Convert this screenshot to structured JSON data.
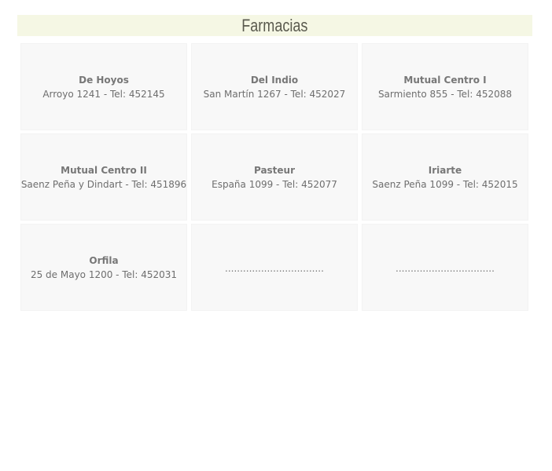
{
  "header": {
    "title": "Farmacias"
  },
  "pharmacies": [
    {
      "name": "De Hoyos",
      "detail": "Arroyo 1241 - Tel: 452145"
    },
    {
      "name": "Del Indio",
      "detail": "San Martín 1267 - Tel: 452027"
    },
    {
      "name": "Mutual Centro I",
      "detail": "Sarmiento 855 - Tel: 452088"
    },
    {
      "name": "Mutual Centro II",
      "detail": "Saenz Peña y Dindart - Tel: 451896"
    },
    {
      "name": "Pasteur",
      "detail": "España 1099 - Tel: 452077"
    },
    {
      "name": "Iriarte",
      "detail": "Saenz Peña 1099 - Tel: 452015"
    },
    {
      "name": "Orfila",
      "detail": "25 de Mayo 1200 - Tel: 452031"
    }
  ],
  "placeholders": [
    ".................................",
    "................................."
  ],
  "colors": {
    "header_bg": "#f5f7e4",
    "card_bg": "#f8f8f8",
    "title_text": "#5a5a4e",
    "card_text": "#777777"
  }
}
